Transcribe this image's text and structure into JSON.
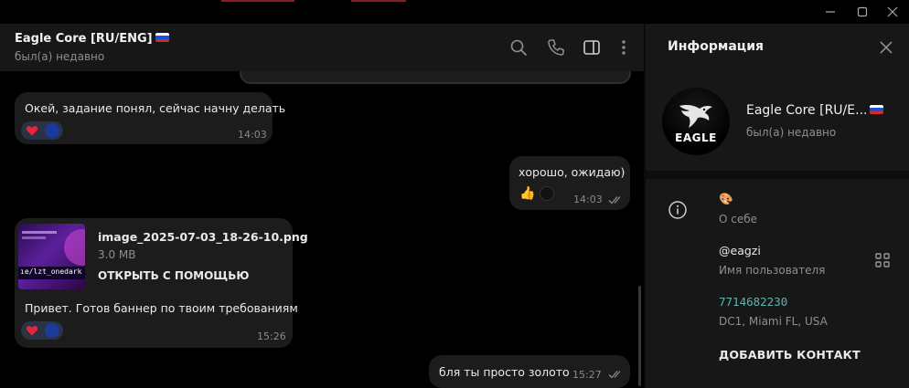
{
  "window": {
    "controls": [
      "minimize-icon",
      "maximize-icon",
      "close-icon"
    ]
  },
  "header": {
    "title": "Eagle Core [RU/ENG]",
    "status": "был(а) недавно",
    "icons": [
      "search-icon",
      "phone-icon",
      "sidebar-toggle-icon",
      "more-vertical-icon"
    ]
  },
  "messages": [
    {
      "id": "m1",
      "direction": "in",
      "text": "Окей, задание понял, сейчас начну делать",
      "time": "14:03",
      "reactions": [
        "heart",
        "avatar"
      ]
    },
    {
      "id": "m2",
      "direction": "out",
      "text": "хорошо, ожидаю)",
      "time": "14:03",
      "reactions": [
        "thumbs-up",
        "avatar"
      ],
      "read": true
    },
    {
      "id": "m3",
      "direction": "in",
      "file": {
        "name": "image_2025-07-03_18-26-10.png",
        "size": "3.0 MB",
        "action": "ОТКРЫТЬ С ПОМОЩЬЮ",
        "thumb_label": "ıe/lzt_onedark"
      },
      "text": "Привет. Готов баннер по твоим требованиям",
      "time": "15:26",
      "reactions": [
        "heart",
        "avatar"
      ]
    },
    {
      "id": "m4",
      "direction": "out",
      "text": "бля ты просто золото",
      "time": "15:27",
      "read": true
    }
  ],
  "info": {
    "title": "Информация",
    "avatar_text": "EAGLE",
    "name": "Eagle Core [RU/E...",
    "status": "был(а) недавно",
    "bio_value": "🎨",
    "bio_label": "О себе",
    "username_value": "@eagzi",
    "username_label": "Имя пользователя",
    "phone_value": "7714682230",
    "phone_label": "DC1, Miami FL, USA",
    "add_contact": "ДОБАВИТЬ КОНТАКТ"
  },
  "colors": {
    "background": "#000000",
    "panel": "#171717",
    "bubble": "#1c1c1c",
    "muted_text": "#8f8f8f",
    "phone_link": "#5cb5b0",
    "reaction_pill": "#2a3243"
  }
}
